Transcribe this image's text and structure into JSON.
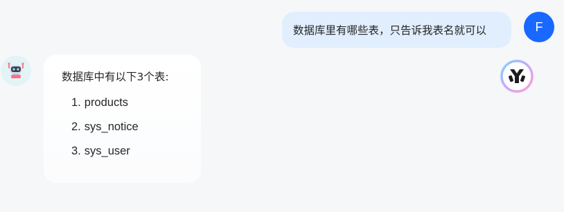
{
  "user_message": {
    "text": "数据库里有哪些表，只告诉我表名就可以",
    "avatar_initial": "F",
    "avatar_color": "#1968ff"
  },
  "bot_message": {
    "avatar_icon": "robot-icon",
    "intro": "数据库中有以下3个表:",
    "tables": [
      {
        "number": "1.",
        "name": "products"
      },
      {
        "number": "2.",
        "name": "sys_notice"
      },
      {
        "number": "3.",
        "name": "sys_user"
      }
    ]
  },
  "brand_logo": {
    "icon": "brand-logo-icon"
  },
  "colors": {
    "page_background": "#f6f7f9",
    "user_bubble": "#e1eefe",
    "bot_bubble": "#ffffff",
    "bot_avatar_background": "#e3f4f7",
    "text": "#262626"
  }
}
